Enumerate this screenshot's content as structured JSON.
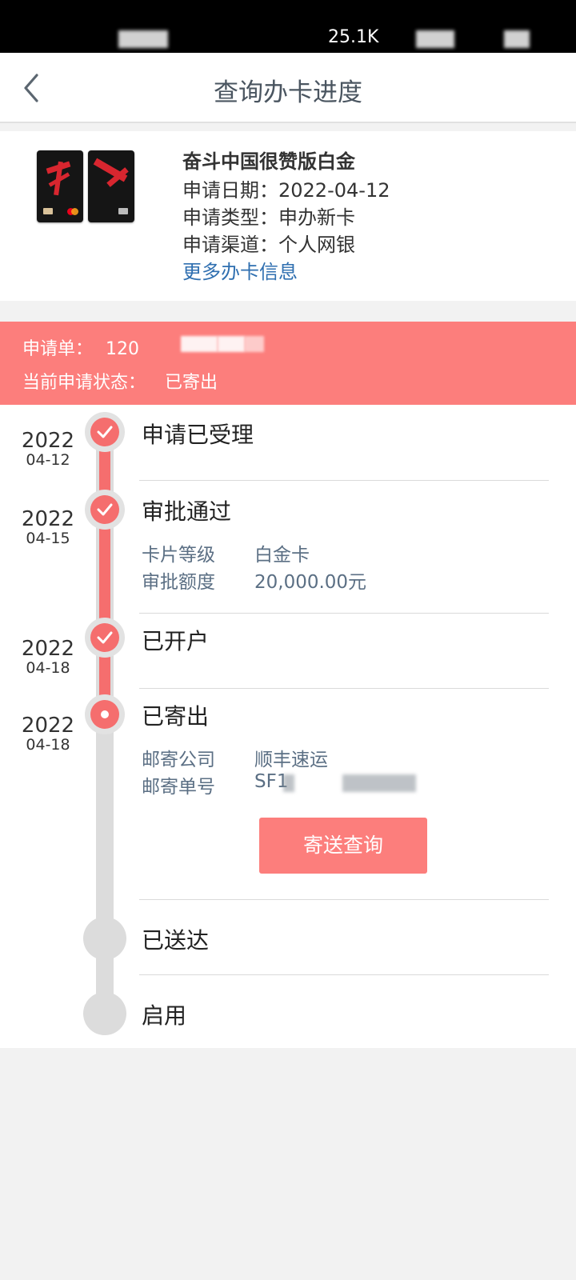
{
  "status_bar": {
    "network_speed": "25.1K"
  },
  "header": {
    "title": "查询办卡进度",
    "back_icon": "chevron-left-icon"
  },
  "card": {
    "name": "奋斗中国很赞版白金",
    "apply_date_label": "申请日期：",
    "apply_date": "2022-04-12",
    "apply_type_label": "申请类型：",
    "apply_type": "申办新卡",
    "channel_label": "申请渠道：",
    "channel": "个人网银",
    "more_link": "更多办卡信息"
  },
  "banner": {
    "order_label": "申请单：",
    "order_number_visible": "120",
    "status_label": "当前申请状态：",
    "status_value": "已寄出",
    "background_color": "#fc7e7c"
  },
  "timeline": {
    "steps": [
      {
        "year": "2022",
        "date": "04-12",
        "title": "申请已受理",
        "state": "done"
      },
      {
        "year": "2022",
        "date": "04-15",
        "title": "审批通过",
        "state": "done",
        "details": [
          {
            "label": "卡片等级",
            "value": "白金卡"
          },
          {
            "label": "审批额度",
            "value": "20,000.00元"
          }
        ]
      },
      {
        "year": "2022",
        "date": "04-18",
        "title": "已开户",
        "state": "done"
      },
      {
        "year": "2022",
        "date": "04-18",
        "title": "已寄出",
        "state": "current",
        "details": [
          {
            "label": "邮寄公司",
            "value": "顺丰速运"
          },
          {
            "label": "邮寄单号",
            "value": "SF1"
          }
        ],
        "button": "寄送查询"
      },
      {
        "title": "已送达",
        "state": "pending"
      },
      {
        "title": "启用",
        "state": "pending"
      }
    ],
    "accent_color": "#f56e6e"
  }
}
